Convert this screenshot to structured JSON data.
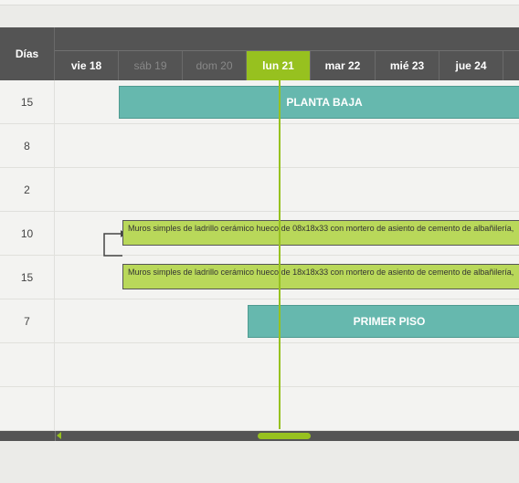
{
  "header": {
    "days_label": "Días",
    "dates": [
      {
        "label": "vie 18",
        "type": "weekday"
      },
      {
        "label": "sáb 19",
        "type": "weekend"
      },
      {
        "label": "dom 20",
        "type": "weekend"
      },
      {
        "label": "lun 21",
        "type": "today"
      },
      {
        "label": "mar 22",
        "type": "weekday"
      },
      {
        "label": "mié 23",
        "type": "weekday"
      },
      {
        "label": "jue 24",
        "type": "weekday"
      }
    ]
  },
  "rows": [
    {
      "days": "15"
    },
    {
      "days": "8"
    },
    {
      "days": "2"
    },
    {
      "days": "10"
    },
    {
      "days": "15"
    },
    {
      "days": "7"
    },
    {
      "days": ""
    },
    {
      "days": ""
    }
  ],
  "bars": {
    "planta_baja": "PLANTA BAJA",
    "task_1": "Muros simples de ladrillo cerámico hueco de 08x18x33 con mortero de asiento de cemento de albañilería,",
    "task_2": "Muros simples de ladrillo cerámico hueco de 18x18x33 con mortero de asiento de cemento de albañilería,",
    "primer_piso": "PRIMER PISO"
  },
  "colors": {
    "header_bg": "#545454",
    "today_accent": "#97c11f",
    "summary_bar": "#66b8ae",
    "task_bar": "#b9d85a"
  }
}
